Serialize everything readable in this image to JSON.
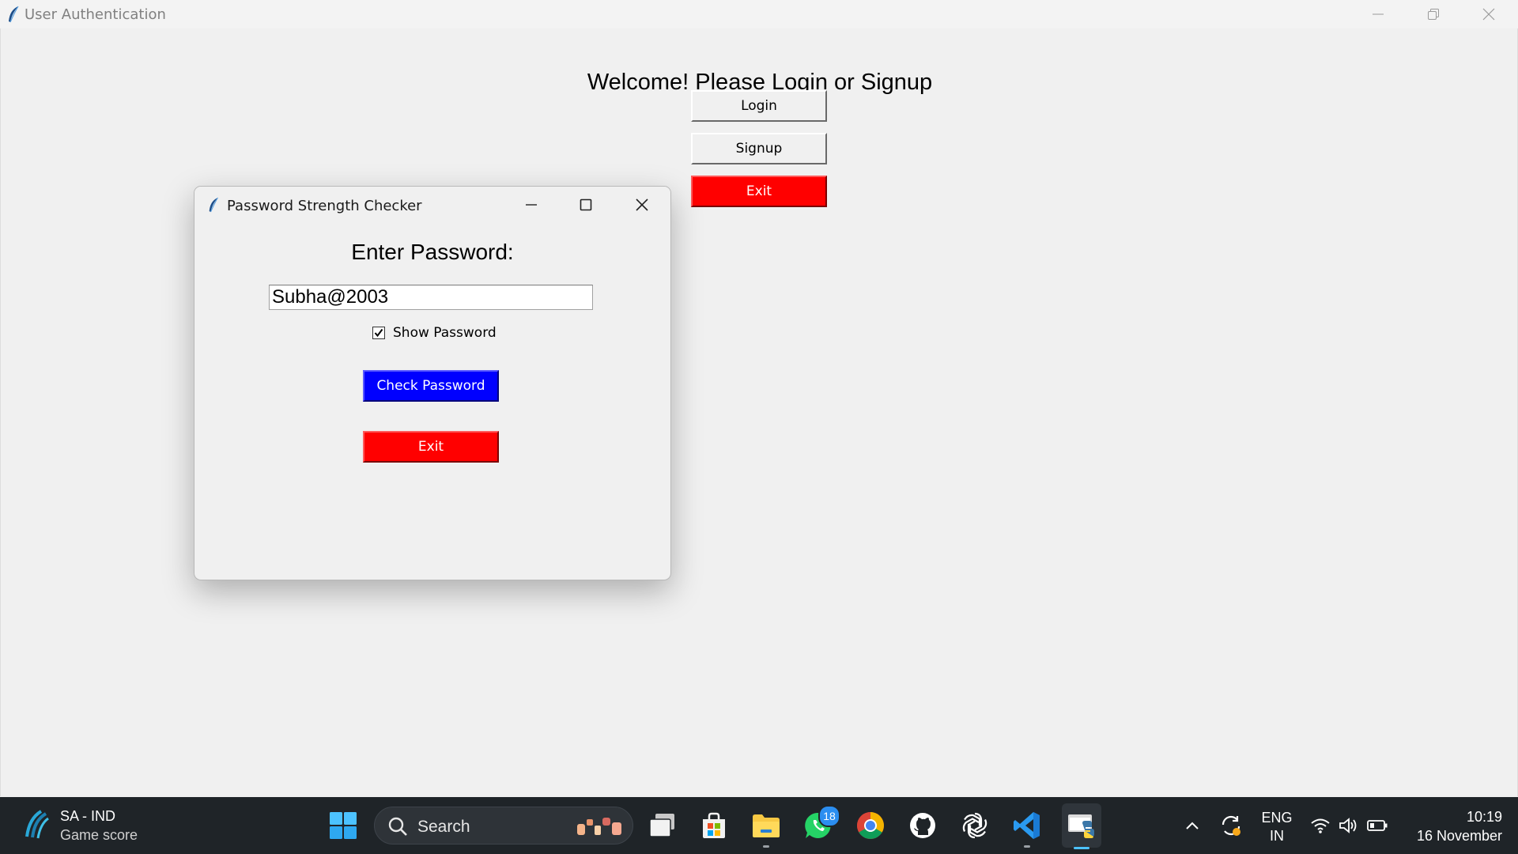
{
  "main_window": {
    "title": "User Authentication",
    "welcome": "Welcome! Please Login or Signup",
    "login_label": "Login",
    "signup_label": "Signup",
    "exit_label": "Exit"
  },
  "dialog": {
    "title": "Password Strength Checker",
    "enter_label": "Enter Password:",
    "password_value": "Subha@2003",
    "show_password_label": "Show Password",
    "show_password_checked": true,
    "check_label": "Check Password",
    "exit_label": "Exit"
  },
  "taskbar": {
    "weather_line1": "SA - IND",
    "weather_line2": "Game score",
    "search_label": "Search",
    "whatsapp_badge": "18",
    "lang_line1": "ENG",
    "lang_line2": "IN",
    "time": "10:19",
    "date": "16 November"
  },
  "colors": {
    "exit_red": "#ff0000",
    "check_blue": "#0000ff",
    "taskbar_bg": "#1f2428"
  },
  "icons": [
    "feather-icon",
    "minimize-icon",
    "restore-icon",
    "maximize-icon",
    "close-icon",
    "windows-start-icon",
    "search-icon",
    "task-view-icon",
    "store-icon",
    "file-explorer-icon",
    "whatsapp-icon",
    "chrome-icon",
    "github-icon",
    "chatgpt-icon",
    "vscode-icon",
    "python-idle-icon",
    "chevron-up-icon",
    "sync-icon",
    "wifi-icon",
    "volume-icon",
    "battery-icon",
    "cricket-icon"
  ]
}
